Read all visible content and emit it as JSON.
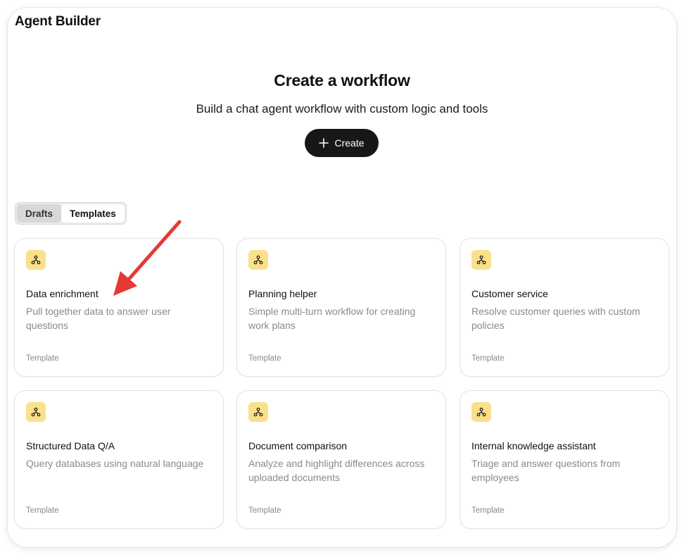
{
  "app": {
    "title": "Agent Builder"
  },
  "hero": {
    "title": "Create a workflow",
    "subtitle": "Build a chat agent workflow with custom logic and tools",
    "create_label": "Create"
  },
  "tabs": [
    {
      "label": "Drafts",
      "selected": false
    },
    {
      "label": "Templates",
      "selected": true
    }
  ],
  "cards": [
    {
      "title": "Data enrichment",
      "description": "Pull together data to answer user questions",
      "tag": "Template",
      "icon": "workflow-icon"
    },
    {
      "title": "Planning helper",
      "description": "Simple multi-turn workflow for creating work plans",
      "tag": "Template",
      "icon": "workflow-icon"
    },
    {
      "title": "Customer service",
      "description": "Resolve customer queries with custom policies",
      "tag": "Template",
      "icon": "workflow-icon"
    },
    {
      "title": "Structured Data Q/A",
      "description": "Query databases using natural language",
      "tag": "Template",
      "icon": "workflow-icon"
    },
    {
      "title": "Document comparison",
      "description": "Analyze and highlight differences across uploaded documents",
      "tag": "Template",
      "icon": "workflow-icon"
    },
    {
      "title": "Internal knowledge assistant",
      "description": "Triage and answer questions from employees",
      "tag": "Template",
      "icon": "workflow-icon"
    }
  ],
  "colors": {
    "accent_button": "#171717",
    "card_icon_bg": "#fbe08a",
    "annotation_arrow": "#e53935"
  }
}
